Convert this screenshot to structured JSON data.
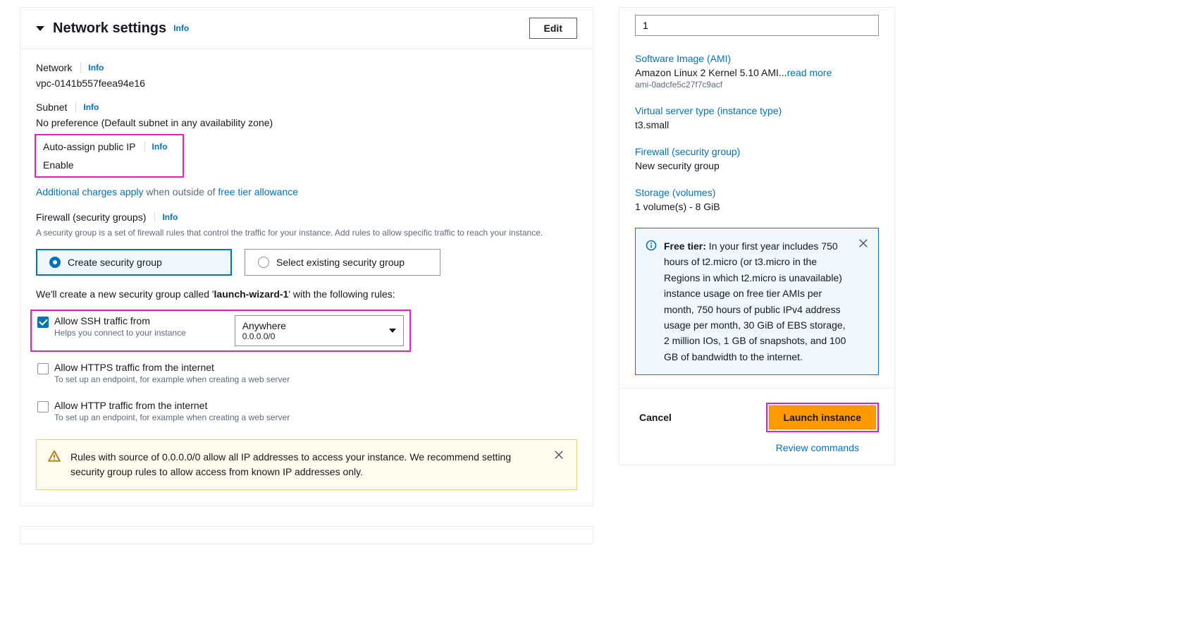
{
  "panel": {
    "title": "Network settings",
    "info": "Info",
    "edit": "Edit"
  },
  "network": {
    "label": "Network",
    "info": "Info",
    "value": "vpc-0141b557feea94e16"
  },
  "subnet": {
    "label": "Subnet",
    "info": "Info",
    "value": "No preference (Default subnet in any availability zone)"
  },
  "publicIp": {
    "label": "Auto-assign public IP",
    "info": "Info",
    "value": "Enable"
  },
  "charges": {
    "link1": "Additional charges apply",
    "middle": " when outside of ",
    "link2": "free tier allowance"
  },
  "firewall": {
    "label": "Firewall (security groups)",
    "info": "Info",
    "desc": "A security group is a set of firewall rules that control the traffic for your instance. Add rules to allow specific traffic to reach your instance.",
    "createOption": "Create security group",
    "selectOption": "Select existing security group",
    "sentence_pre": "We'll create a new security group called '",
    "sentence_name": "launch-wizard-1",
    "sentence_post": "' with the following rules:"
  },
  "rules": {
    "ssh": {
      "title": "Allow SSH traffic from",
      "help": "Helps you connect to your instance",
      "selectMain": "Anywhere",
      "selectSub": "0.0.0.0/0"
    },
    "https": {
      "title": "Allow HTTPS traffic from the internet",
      "help": "To set up an endpoint, for example when creating a web server"
    },
    "http": {
      "title": "Allow HTTP traffic from the internet",
      "help": "To set up an endpoint, for example when creating a web server"
    }
  },
  "warning": {
    "text": "Rules with source of 0.0.0.0/0 allow all IP addresses to access your instance. We recommend setting security group rules to allow access from known IP addresses only."
  },
  "summary": {
    "instanceCount": "1",
    "ami": {
      "label": "Software Image (AMI)",
      "value": "Amazon Linux 2 Kernel 5.10 AMI...",
      "readmore": "read more",
      "id": "ami-0adcfe5c27f7c9acf"
    },
    "instanceType": {
      "label": "Virtual server type (instance type)",
      "value": "t3.small"
    },
    "firewall": {
      "label": "Firewall (security group)",
      "value": "New security group"
    },
    "storage": {
      "label": "Storage (volumes)",
      "value": "1 volume(s) - 8 GiB"
    },
    "freeTier": {
      "lead": "Free tier:",
      "body": " In your first year includes 750 hours of t2.micro (or t3.micro in the Regions in which t2.micro is unavailable) instance usage on free tier AMIs per month, 750 hours of public IPv4 address usage per month, 30 GiB of EBS storage, 2 million IOs, 1 GB of snapshots, and 100 GB of bandwidth to the internet."
    },
    "footer": {
      "cancel": "Cancel",
      "launch": "Launch instance",
      "review": "Review commands"
    }
  }
}
